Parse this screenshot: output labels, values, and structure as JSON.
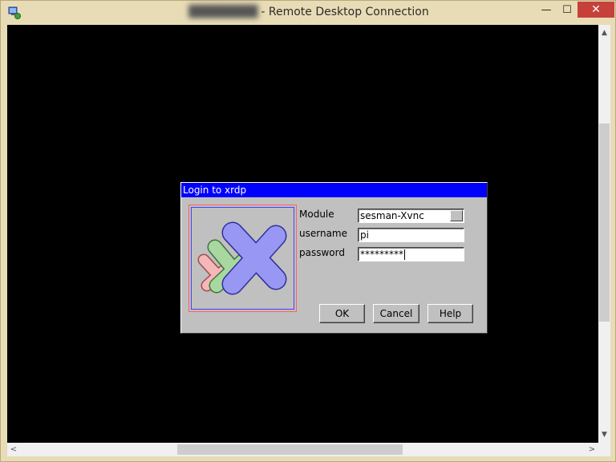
{
  "window": {
    "title_blurred": "████████",
    "title": "- Remote Desktop Connection",
    "minimize_glyph": "—",
    "maximize_glyph": "☐",
    "close_glyph": "✕",
    "icon": "remote-desktop-icon"
  },
  "dialog": {
    "title": "Login to xrdp",
    "logo": "xrdp-logo",
    "fields": {
      "module_label": "Module",
      "module_value": "sesman-Xvnc",
      "username_label": "username",
      "username_value": "pi",
      "password_label": "password",
      "password_value": "*********"
    },
    "buttons": {
      "ok": "OK",
      "cancel": "Cancel",
      "help": "Help"
    }
  },
  "scrollbars": {
    "up_glyph": "▲",
    "down_glyph": "▼",
    "left_glyph": "<",
    "right_glyph": ">"
  },
  "colors": {
    "dialog_title_bar": "#0000ff",
    "dialog_bg": "#c0c0c0",
    "close_button": "#c7413b",
    "desktop_bg": "#000000"
  }
}
